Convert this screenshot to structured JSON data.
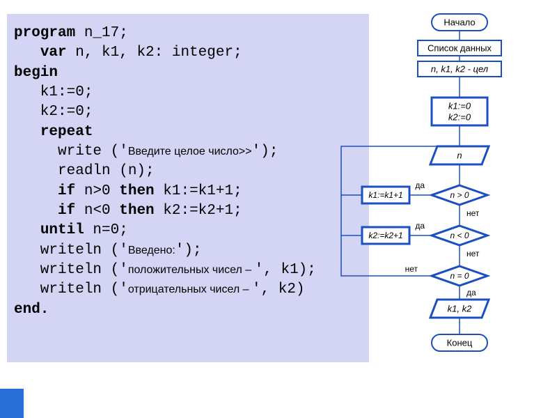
{
  "code": {
    "l1p1": "program",
    "l1p2": " n_17;",
    "l2pad": "   ",
    "l2p1": "var",
    "l2p2": " n, k1, k2: integer;",
    "l3": "begin",
    "l4": "   k1:=0;",
    "l5": "   k2:=0;",
    "l6pad": "   ",
    "l6": "repeat",
    "l7a": "     write ('",
    "l7b": "Введите целое число>>",
    "l7c": "');",
    "l8": "     readln (n);",
    "l9pad": "     ",
    "l9p1": "if",
    "l9p2": " n>0 ",
    "l9p3": "then",
    "l9p4": " k1:=k1+1;",
    "l10pad": "     ",
    "l10p1": "if",
    "l10p2": " n<0 ",
    "l10p3": "then",
    "l10p4": " k2:=k2+1;",
    "l11pad": "   ",
    "l11p1": "until",
    "l11p2": " n=0;",
    "l12a": "   writeln ('",
    "l12b": "Введено:",
    "l12c": "');",
    "l13a": "   writeln ('",
    "l13b": "положительных чисел – ",
    "l13c": "', k1);",
    "l14a": "   writeln ('",
    "l14b": "отрицательных чисел – ",
    "l14c": "', k2)",
    "l15": "end."
  },
  "flow": {
    "start": "Начало",
    "data1": "Список данных",
    "data2": "n, k1, k2 - цел",
    "init1": "k1:=0",
    "init2": "k2:=0",
    "input": "n",
    "cond1": "n > 0",
    "cond2": "n < 0",
    "cond3": "n = 0",
    "proc1": "k1:=k1+1",
    "proc2": "k2:=k2+1",
    "output": "k1, k2",
    "end": "Конец",
    "yes": "да",
    "no": "нет"
  }
}
